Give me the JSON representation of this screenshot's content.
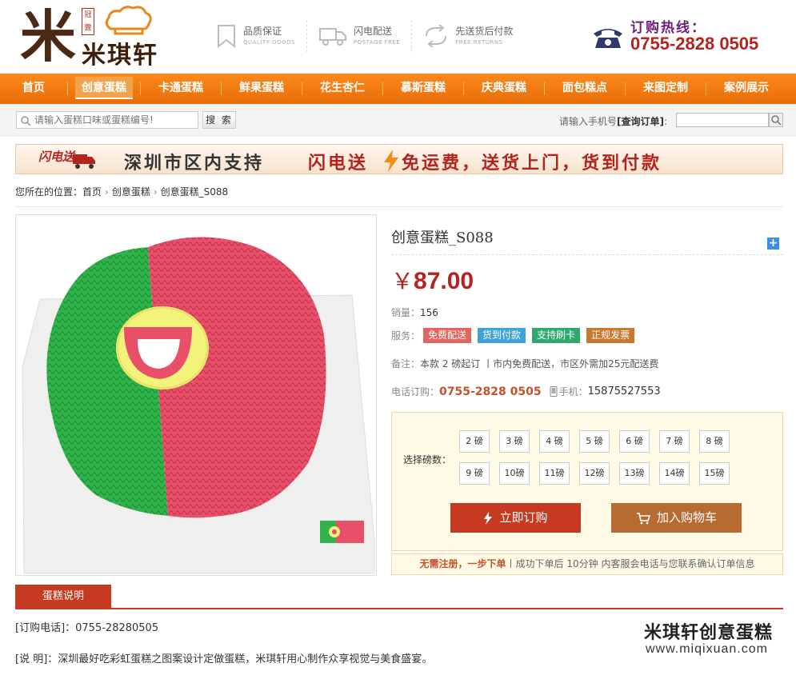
{
  "brand": {
    "logo_char": "米",
    "seal_text": "冠壹",
    "name": "米琪轩"
  },
  "features": [
    {
      "title": "品质保证",
      "sub": "QUALITY GOODS",
      "icon": "bookmark-icon"
    },
    {
      "title": "闪电配送",
      "sub": "POSTAGE FREE",
      "icon": "truck-icon"
    },
    {
      "title": "先送货后付款",
      "sub": "FREE RETURNS",
      "icon": "return-icon"
    }
  ],
  "hotline": {
    "label": "订购热线：",
    "number": "0755-2828 0505"
  },
  "nav": [
    "首页",
    "创意蛋糕",
    "卡通蛋糕",
    "鲜果蛋糕",
    "花生杏仁",
    "慕斯蛋糕",
    "庆典蛋糕",
    "面包糕点",
    "来图定制",
    "案例展示"
  ],
  "search": {
    "placeholder": "请输入蛋糕口味或蛋糕编号!",
    "button": "搜 索"
  },
  "order_query": {
    "prefix": "请输入手机号",
    "bold": "[查询订单]",
    "suffix": ":"
  },
  "banner": {
    "badge": "闪电送",
    "text1": "深圳市区内支持",
    "text2": "闪电送",
    "text3": "免运费，送货上门，货到付款"
  },
  "breadcrumb": {
    "prefix": "您所在的位置：",
    "items": [
      "首页",
      "创意蛋糕",
      "创意蛋糕_S088"
    ]
  },
  "product": {
    "title": "创意蛋糕_S088",
    "currency": "￥",
    "price": "87.00",
    "sales_label": "销量：",
    "sales": "156",
    "service_label": "服务：",
    "services": [
      {
        "label": "免费配送",
        "color": "#e0665f"
      },
      {
        "label": "货到付款",
        "color": "#3fa3d8"
      },
      {
        "label": "支持刷卡",
        "color": "#2fa86f"
      },
      {
        "label": "正规发票",
        "color": "#c9782f"
      }
    ],
    "note_label": "备注：",
    "note": "本款 2 磅起订 丨市内免费配送，市区外需加25元配送费",
    "phone_label": "电话订购：",
    "phone": "0755-2828 0505",
    "mobile_label": "手机：",
    "mobile": "15875527553"
  },
  "options": {
    "label": "选择磅数：",
    "sizes": [
      "2 磅",
      "3 磅",
      "4 磅",
      "5 磅",
      "6 磅",
      "7 磅",
      "8 磅",
      "9 磅",
      "10磅",
      "11磅",
      "12磅",
      "13磅",
      "14磅",
      "15磅"
    ],
    "buy": "立即订购",
    "cart": "加入购物车",
    "foot_hi": "无需注册，一步下单",
    "foot_rest": "丨成功下单后 10分钟 内客服会电话与您联系确认订单信息"
  },
  "description": {
    "tab": "蛋糕说明",
    "line1": "[订购电话]：0755-28280505",
    "line2": "[说 明]：深圳最好吃彩虹蛋糕之图案设计定做蛋糕，米琪轩用心制作众享视觉与美食盛宴。",
    "watermark_title": "米琪轩创意蛋糕",
    "watermark_url": "www.miqixuan.com"
  },
  "colors": {
    "nav_orange": "#f07a10",
    "accent_red": "#b3241f",
    "cake_green": "#2fb34a",
    "cake_pink": "#e8506a",
    "cake_yellow": "#f3f27a"
  }
}
